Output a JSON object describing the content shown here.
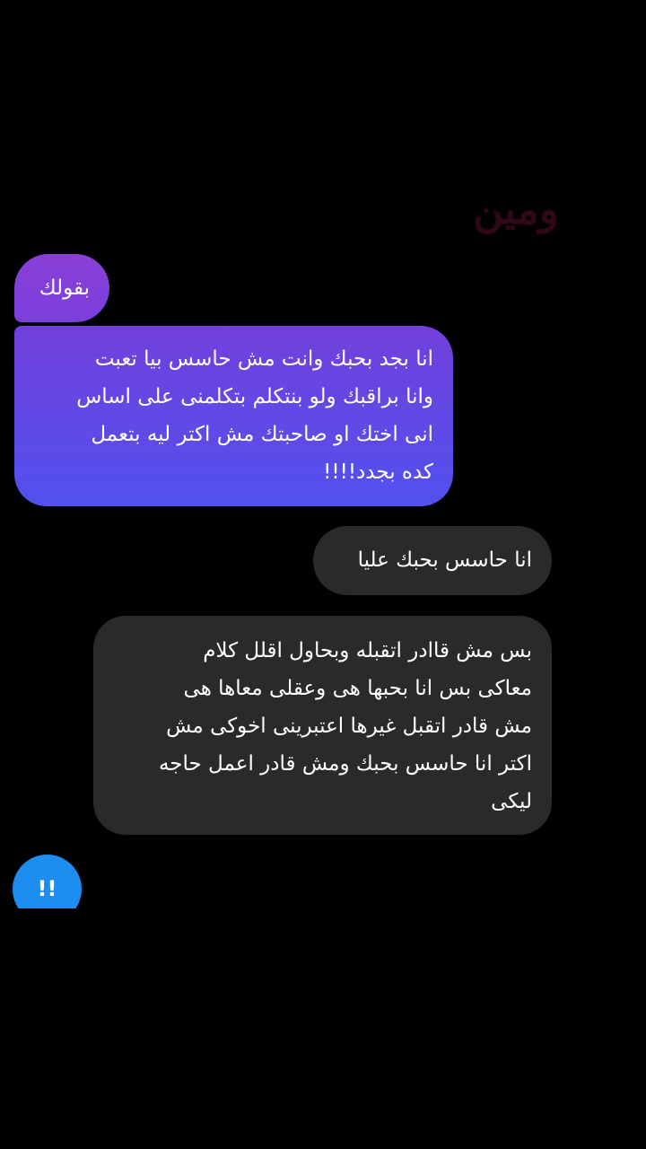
{
  "watermark": {
    "text": "ومين"
  },
  "messages": [
    {
      "side": "sent",
      "text": "بقولك"
    },
    {
      "side": "sent",
      "text": "انا بجد بحبك وانت مش حاسس بيا تعبت\nوانا براقبك ولو بنتكلم بتكلمنى على اساس\nانى اختك او صاحبتك مش اكتر ليه بتعمل\nكده بجدد!!!!"
    },
    {
      "side": "received",
      "text": "انا حاسس بحبك عليا"
    },
    {
      "side": "received",
      "text": "بس مش قاادر اتقبله وبحاول اقلل كلام\nمعاكى بس انا بحبها هى وعقلى معاها هى\nمش قادر اتقبل غيرها اعتبرينى اخوكى مش\nاكتر انا حاسس بحبك ومش قادر اعمل حاجه\nليكى"
    }
  ],
  "reaction": {
    "text": "!!"
  },
  "colors": {
    "background": "#000000",
    "sent_bubble_top": "#7a3fd9",
    "sent_bubble_bottom": "#5a4ff0",
    "received_bubble": "#2a2a2c",
    "reaction_badge": "#1d8ef0",
    "watermark": "#3a0a1e"
  }
}
